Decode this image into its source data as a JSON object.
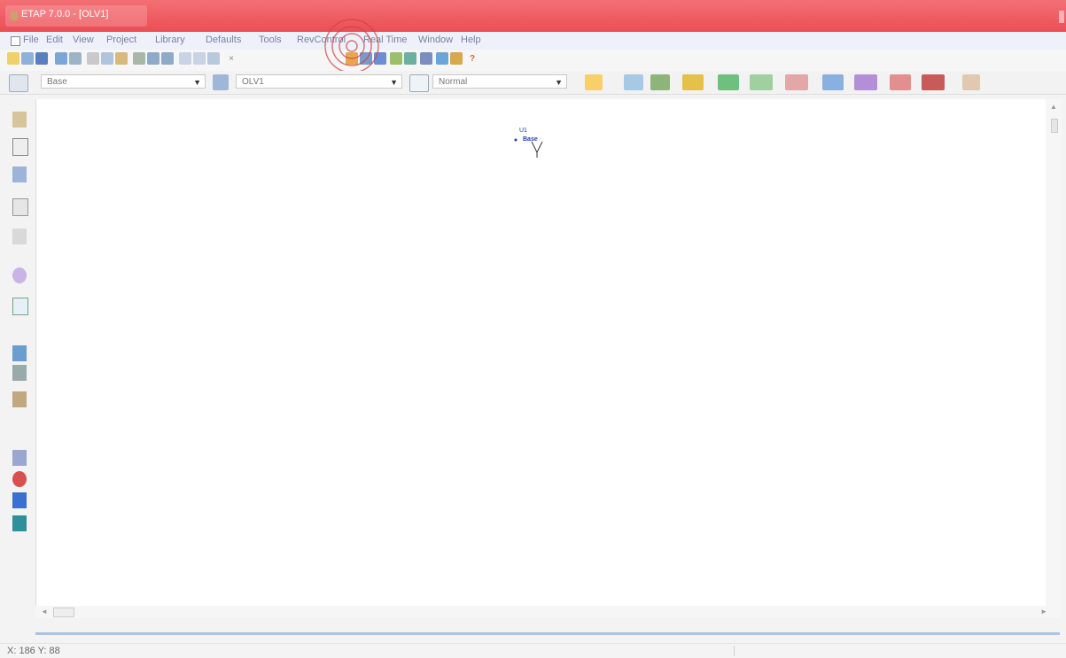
{
  "window": {
    "title": "ETAP 7.0.0 - [OLV1]"
  },
  "menu": {
    "items": [
      "File",
      "Edit",
      "View",
      "Project",
      "Library",
      "Defaults",
      "Tools",
      "RevControl",
      "Real Time",
      "Window",
      "Help"
    ]
  },
  "toolbar2": {
    "presentation_combo": "Base",
    "revision_combo": "OLV1",
    "config_combo": "Normal"
  },
  "canvas": {
    "element_label_top": "U1",
    "element_label_main": "Base"
  },
  "status": {
    "coordinates": "X: 186    Y: 88"
  },
  "colors": {
    "titlebar": "#ec4e55",
    "canvas": "#ffffff",
    "scroll_divider": "#a9c3e3"
  }
}
